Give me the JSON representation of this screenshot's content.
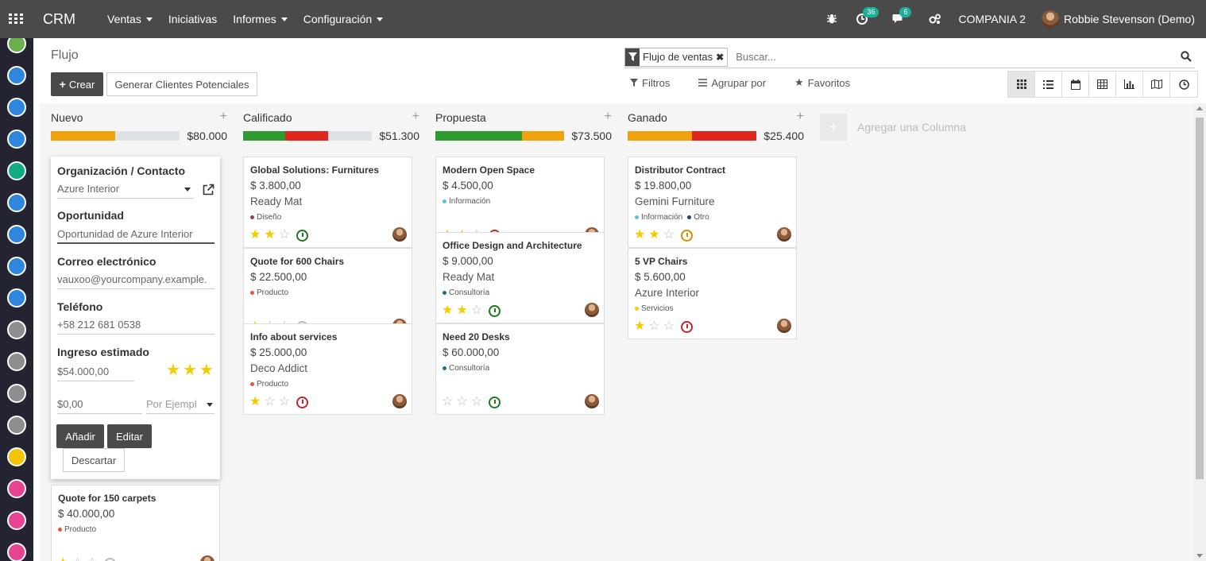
{
  "navbar": {
    "app_name": "CRM",
    "menu": [
      "Ventas",
      "Iniciativas",
      "Informes",
      "Configuración"
    ],
    "menu_has_dropdown": [
      true,
      false,
      true,
      true
    ],
    "activity_count": "36",
    "message_count": "6",
    "company": "COMPANIA 2",
    "user": "Robbie Stevenson (Demo)"
  },
  "sidebar_apps": [
    "#6ab04c",
    "#2e86de",
    "#2e86de",
    "#2e86de",
    "#10ac84",
    "#2e86de",
    "#2e86de",
    "#2e86de",
    "#2e86de",
    "#8e8e8e",
    "#8e8e8e",
    "#8e8e8e",
    "#8e8e8e",
    "#f5c400",
    "#e84393",
    "#e84393",
    "#e84393"
  ],
  "control": {
    "breadcrumb": "Flujo",
    "create_label": "Crear",
    "generate_label": "Generar Clientes Potenciales",
    "facet_label": "Flujo de ventas",
    "search_placeholder": "Buscar...",
    "filters_label": "Filtros",
    "group_label": "Agrupar por",
    "favorites_label": "Favoritos"
  },
  "quick_create": {
    "org_label": "Organización / Contacto",
    "org_value": "Azure Interior",
    "opp_label": "Oportunidad",
    "opp_value": "Oportunidad de Azure Interior",
    "email_label": "Correo electrónico",
    "email_value": "vauxoo@yourcompany.example.",
    "phone_label": "Teléfono",
    "phone_value": "+58 212 681 0538",
    "revenue_label": "Ingreso estimado",
    "revenue_value": "$54.000,00",
    "priority": 3,
    "recurring_value": "$0,00",
    "recurring_placeholder": "Por Ejempl",
    "add_label": "Añadir",
    "edit_label": "Editar",
    "discard_label": "Descartar"
  },
  "columns": [
    {
      "name": "Nuevo",
      "total": "$80.000",
      "bar": [
        {
          "color": "#f0a20e",
          "ratio": 0.5
        }
      ],
      "cards": [
        {
          "title": "Quote for 150 carpets",
          "amount": "$ 40.000,00",
          "partner": "",
          "tags": [
            {
              "name": "Producto",
              "color": "#e8533d"
            }
          ],
          "stars": 1,
          "activity": "grey"
        }
      ]
    },
    {
      "name": "Calificado",
      "total": "$51.300",
      "bar": [
        {
          "color": "#2f9a2f",
          "ratio": 0.33
        },
        {
          "color": "#e0261f",
          "ratio": 0.33
        }
      ],
      "cards": [
        {
          "title": "Global Solutions: Furnitures",
          "amount": "$ 3.800,00",
          "partner": "Ready Mat",
          "tags": [
            {
              "name": "Diseño",
              "color": "#8e3d5a"
            }
          ],
          "stars": 2,
          "activity": "green"
        },
        {
          "title": "Quote for 600 Chairs",
          "amount": "$ 22.500,00",
          "partner": "",
          "tags": [
            {
              "name": "Producto",
              "color": "#e8533d"
            }
          ],
          "stars": 1,
          "activity": "grey"
        },
        {
          "title": "Info about services",
          "amount": "$ 25.000,00",
          "partner": "Deco Addict",
          "tags": [
            {
              "name": "Producto",
              "color": "#e8533d"
            }
          ],
          "stars": 1,
          "activity": "red"
        }
      ]
    },
    {
      "name": "Propuesta",
      "total": "$73.500",
      "bar": [
        {
          "color": "#2f9a2f",
          "ratio": 0.67
        },
        {
          "color": "#f0a20e",
          "ratio": 0.33
        }
      ],
      "cards": [
        {
          "title": "Modern Open Space",
          "amount": "$ 4.500,00",
          "partner": "",
          "tags": [
            {
              "name": "Información",
              "color": "#5bc0de"
            }
          ],
          "stars": 2,
          "activity": "red"
        },
        {
          "title": "Office Design and Architecture",
          "amount": "$ 9.000,00",
          "partner": "Ready Mat",
          "tags": [
            {
              "name": "Consultoría",
              "color": "#1f6f8b"
            }
          ],
          "stars": 2,
          "activity": "green"
        },
        {
          "title": "Need 20 Desks",
          "amount": "$ 60.000,00",
          "partner": "",
          "tags": [
            {
              "name": "Consultoría",
              "color": "#1f6f8b"
            }
          ],
          "stars": 0,
          "activity": "green"
        }
      ]
    },
    {
      "name": "Ganado",
      "total": "$25.400",
      "bar": [
        {
          "color": "#f0a20e",
          "ratio": 0.5
        },
        {
          "color": "#e0261f",
          "ratio": 0.5
        }
      ],
      "cards": [
        {
          "title": "Distributor Contract",
          "amount": "$ 19.800,00",
          "partner": "Gemini Furniture",
          "tags": [
            {
              "name": "Información",
              "color": "#5bc0de"
            },
            {
              "name": "Otro",
              "color": "#2c3e70"
            }
          ],
          "stars": 2,
          "activity": "orange"
        },
        {
          "title": "5 VP Chairs",
          "amount": "$ 5.600,00",
          "partner": "Azure Interior",
          "tags": [
            {
              "name": "Servicios",
              "color": "#f3cc00"
            }
          ],
          "stars": 1,
          "activity": "red"
        }
      ]
    }
  ],
  "add_column_label": "Agregar una Columna"
}
